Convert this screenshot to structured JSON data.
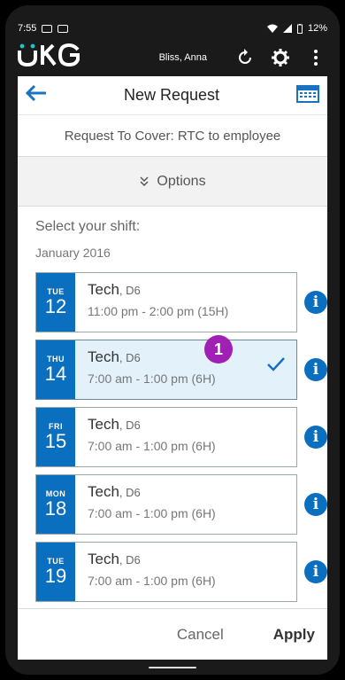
{
  "status": {
    "time": "7:55",
    "battery": "12%"
  },
  "app": {
    "user": "Bliss, Anna"
  },
  "page": {
    "title": "New Request",
    "subtitle": "Request To Cover: RTC to employee",
    "options_label": "Options",
    "select_label": "Select your shift:",
    "month": "January 2016"
  },
  "shifts": [
    {
      "dow": "TUE",
      "day": "12",
      "job": "Tech",
      "loc": ", D6",
      "time": "11:00 pm - 2:00 pm (15H)",
      "selected": false
    },
    {
      "dow": "THU",
      "day": "14",
      "job": "Tech",
      "loc": ", D6",
      "time": "7:00 am - 1:00 pm (6H)",
      "selected": true
    },
    {
      "dow": "FRI",
      "day": "15",
      "job": "Tech",
      "loc": ", D6",
      "time": "7:00 am - 1:00 pm (6H)",
      "selected": false
    },
    {
      "dow": "MON",
      "day": "18",
      "job": "Tech",
      "loc": ", D6",
      "time": "7:00 am - 1:00 pm (6H)",
      "selected": false
    },
    {
      "dow": "TUE",
      "day": "19",
      "job": "Tech",
      "loc": ", D6",
      "time": "7:00 am - 1:00 pm (6H)",
      "selected": false
    }
  ],
  "badge": "1",
  "footer": {
    "cancel": "Cancel",
    "apply": "Apply"
  },
  "colors": {
    "accent": "#0b6fbf",
    "badge": "#a01fb4",
    "selected_bg": "#e3f1fb"
  }
}
